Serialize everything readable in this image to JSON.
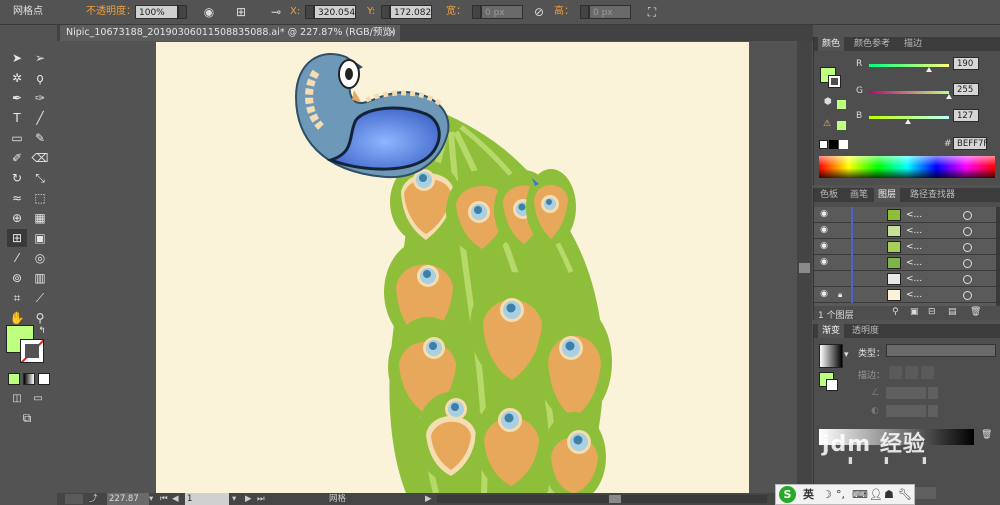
{
  "control_bar": {
    "selection_label": "网格点",
    "opacity_label": "不透明度：",
    "opacity_value": "100%",
    "x_label": "X:",
    "x_value": "320.054",
    "y_label": "Y:",
    "y_value": "172.082",
    "width_label": "宽：",
    "width_value": "0 px",
    "height_label": "高：",
    "height_value": "0 px"
  },
  "document_tab": {
    "title": "Nipic_10673188_20190306011508835088.ai* @ 227.87% (RGB/预览)",
    "close": "×"
  },
  "status_bar": {
    "zoom": "227.87",
    "page": "1",
    "tool_name": "网格"
  },
  "color_panel": {
    "tabs": [
      "颜色",
      "颜色参考",
      "描边"
    ],
    "r_label": "R",
    "r_value": "190",
    "g_label": "G",
    "g_value": "255",
    "b_label": "B",
    "b_value": "127",
    "hex_label": "#",
    "hex_value": "BEFF7F"
  },
  "layers_panel": {
    "tabs": [
      "色板",
      "画笔",
      "图层",
      "路径查找器"
    ],
    "layer_name": "<...",
    "count_label": "1 个图层"
  },
  "gradient_panel": {
    "tabs": [
      "渐变",
      "透明度"
    ],
    "type_label": "类型：",
    "stroke_label": "描边：",
    "type_value": ""
  },
  "watermark": "jdm 经验",
  "taskbar": {
    "ime_logo": "S",
    "ime_lang": "英"
  },
  "colors": {
    "fill": "#BEFF7F",
    "artboard": "#FBF3D9",
    "peacock_body": "#6E98B7",
    "feather_green": "#8FBF3A",
    "feather_orange": "#E7A85C",
    "eye_blue": "#A8CFE2"
  }
}
